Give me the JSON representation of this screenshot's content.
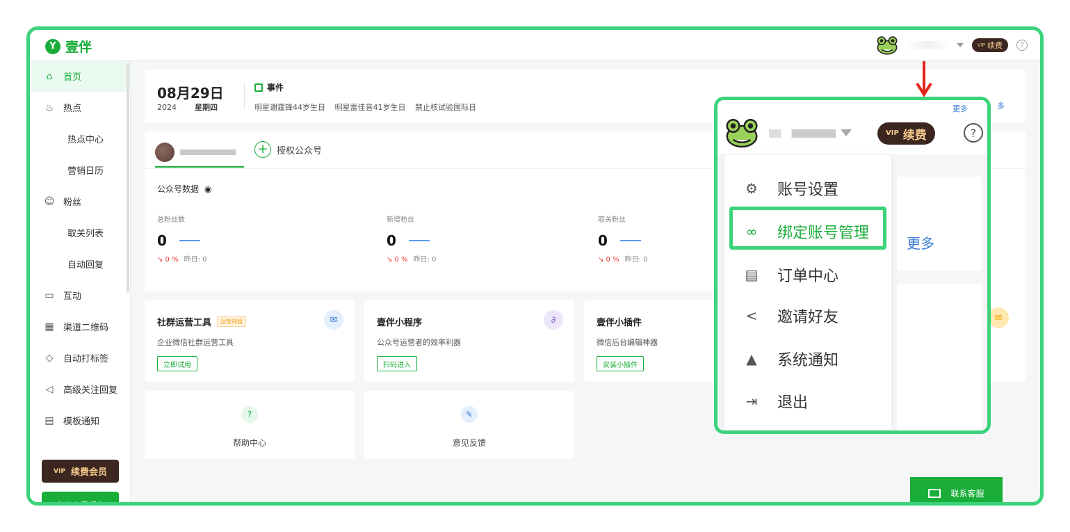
{
  "brand": {
    "logo_glyph": "Y",
    "name": "壹伴"
  },
  "topbar": {
    "vip_label": "续费",
    "vip_crown": "VIP",
    "help": "?"
  },
  "sidebar": {
    "items": [
      {
        "label": "首页",
        "icon": "⌂"
      },
      {
        "label": "热点",
        "icon": "♨"
      },
      {
        "label": "热点中心"
      },
      {
        "label": "营销日历"
      },
      {
        "label": "粉丝",
        "icon": "☺"
      },
      {
        "label": "取关列表"
      },
      {
        "label": "自动回复"
      },
      {
        "label": "互动",
        "icon": "▭"
      },
      {
        "label": "渠道二维码",
        "icon": "▦"
      },
      {
        "label": "自动打标签",
        "icon": "◇"
      },
      {
        "label": "高级关注回复",
        "icon": "◁"
      },
      {
        "label": "模板通知",
        "icon": "▤"
      }
    ],
    "vip_member": "续费会员",
    "go_backend": "去公众号后台"
  },
  "date_card": {
    "date": "08月29日",
    "year": "2024",
    "weekday": "星期四",
    "event_title": "事件",
    "events": [
      "明星谢霆锋44岁生日",
      "明星雷佳音41岁生日",
      "禁止核试验国际日"
    ],
    "more": "多"
  },
  "account": {
    "auth_label": "授权公众号",
    "data_label": "公众号数据",
    "metrics": [
      {
        "label": "总粉丝数",
        "value": "0",
        "change": "↘ 0 %",
        "yesterday": "昨日: 0"
      },
      {
        "label": "新增粉丝",
        "value": "0",
        "change": "↘ 0 %",
        "yesterday": "昨日: 0"
      },
      {
        "label": "取关粉丝",
        "value": "0",
        "change": "↘ 0 %",
        "yesterday": "昨日: 0"
      }
    ]
  },
  "tools": [
    {
      "title": "社群运营工具",
      "tag": "运营神器",
      "desc": "企业微信社群运营工具",
      "button": "立即试用",
      "icon": "✉"
    },
    {
      "title": "壹伴小程序",
      "desc": "公众号运营者的效率利器",
      "button": "扫码进入",
      "icon": "∂"
    },
    {
      "title": "壹伴小插件",
      "desc": "微信后台编辑神器",
      "button": "安装小插件"
    }
  ],
  "help_cards": [
    {
      "label": "帮助中心",
      "icon": "?"
    },
    {
      "label": "意见反馈",
      "icon": "✎"
    }
  ],
  "right_panel": {
    "more": "更多"
  },
  "contact": {
    "label": "联系客服"
  },
  "zoom": {
    "vip_label": "续费",
    "vip_crown": "VIP",
    "help": "?",
    "more": "更多",
    "partial_more": "更多",
    "menu": [
      {
        "label": "账号设置",
        "icon": "⚙"
      },
      {
        "label": "绑定账号管理",
        "icon": "∞"
      },
      {
        "label": "订单中心",
        "icon": "▤"
      },
      {
        "label": "邀请好友",
        "icon": "<"
      },
      {
        "label": "系统通知",
        "icon": "▲"
      },
      {
        "label": "退出",
        "icon": "⇥"
      }
    ]
  },
  "colors": {
    "brand_green": "#1aad3a",
    "highlight_green": "#3dd37a",
    "vip_dark": "#3b2620",
    "vip_gold": "#f3c98b",
    "arrow_red": "#e5231b"
  }
}
